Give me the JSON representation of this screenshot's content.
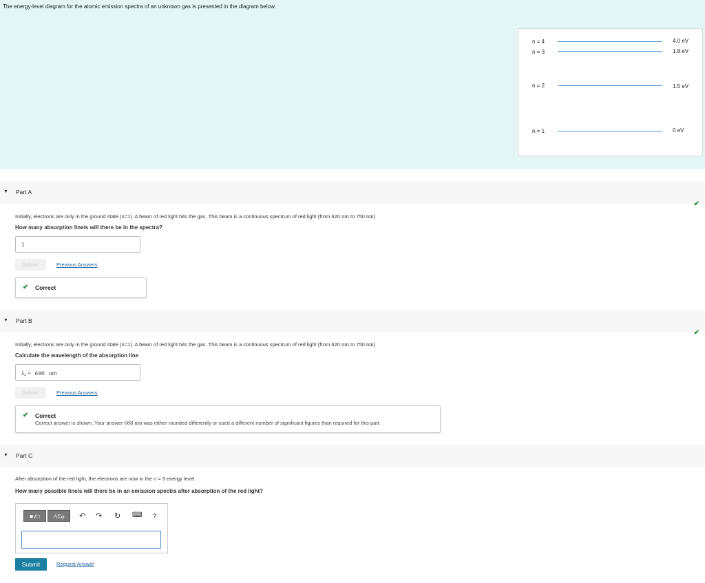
{
  "intro": "The energy-level diagram for the atomic emission spectra of an unknown gas is presented in the diagram below.",
  "diagram": {
    "levels": [
      {
        "n": "n = 4",
        "energy": "4.0 eV"
      },
      {
        "n": "n = 3",
        "energy": "1.8 eV"
      },
      {
        "n": "n = 2",
        "energy": "1.5 eV"
      },
      {
        "n": "n = 1",
        "energy": "0 eV"
      }
    ],
    "line_color": "#4a90d9"
  },
  "partA": {
    "title": "Part A",
    "q_pre": "Initially, electrons are only in the ground state (n=1). A beam of red light hits the gas. This beam is a continuous spectrum of red light (from 620 ",
    "nm1": "nm",
    "q_mid": " to 750 ",
    "nm2": "nm",
    "q_post": ")",
    "question": "How many absorption line/s will there be in the spectra?",
    "answer": "1",
    "submit": "Submit",
    "prev": "Previous Answers",
    "feedback": "Correct"
  },
  "partB": {
    "title": "Part B",
    "q_pre": "Initially, electrons are only in the ground state (n=1). A beam of red light hits the gas. This beam is a continuous spectrum of red light (from 620 ",
    "nm1": "nm",
    "q_mid": " to 750 ",
    "nm2": "nm",
    "q_post": ")",
    "question": "Calculate the wavelength of the absorption line",
    "answer_label": "λₐ =",
    "answer_value": "690",
    "answer_unit": "nm",
    "submit": "Submit",
    "prev": "Previous Answers",
    "feedback": "Correct",
    "fb_pre": "Correct answer is shown. Your answer ",
    "fb_num": "688",
    "fb_unit": "nm",
    "fb_post": " was either rounded differently or used a different number of significant figures than required for this part."
  },
  "partC": {
    "title": "Part C",
    "context": "After absorption of the red light, the electrons are now in the n = 3 energy level.",
    "question": "How many possible line/s will there be in an emission spectra after absorption of the red light?",
    "tb_templates": "■√□",
    "tb_symbols": "ΑΣφ",
    "tb_help": "?",
    "submit": "Submit",
    "request": "Request Answer"
  },
  "colors": {
    "accent": "#1a7fa0",
    "check": "#2a8c3a",
    "intro_bg": "#e4f5f5"
  }
}
